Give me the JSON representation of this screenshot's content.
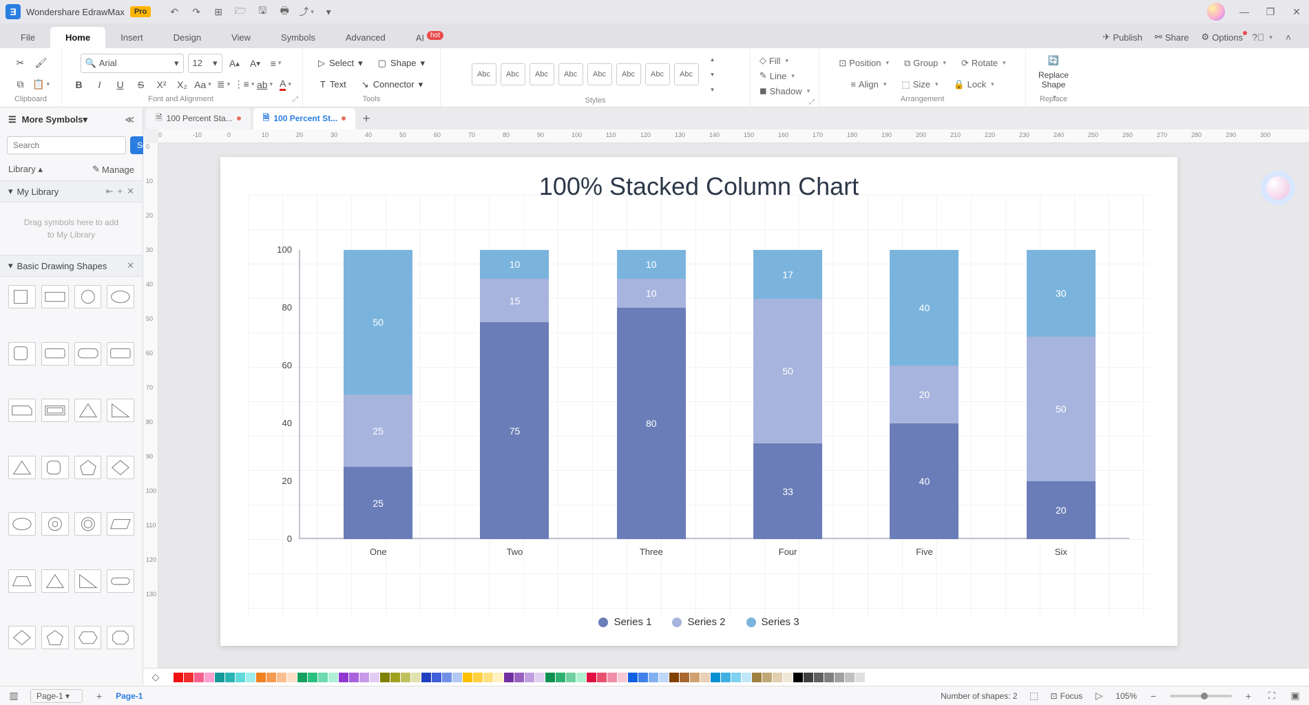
{
  "app": {
    "name": "Wondershare EdrawMax",
    "badge": "Pro"
  },
  "menu": {
    "tabs": [
      "File",
      "Home",
      "Insert",
      "Design",
      "View",
      "Symbols",
      "Advanced",
      "AI"
    ],
    "active": 1,
    "hot_on": 7,
    "right": {
      "publish": "Publish",
      "share": "Share",
      "options": "Options"
    }
  },
  "ribbon": {
    "clipboard": "Clipboard",
    "font_align": "Font and Alignment",
    "font_name": "Arial",
    "font_size": "12",
    "tools": {
      "label": "Tools",
      "select": "Select",
      "shape": "Shape",
      "text": "Text",
      "connector": "Connector"
    },
    "styles": {
      "label": "Styles",
      "sample": "Abc"
    },
    "effects": {
      "fill": "Fill",
      "line": "Line",
      "shadow": "Shadow"
    },
    "arrange": {
      "label": "Arrangement",
      "position": "Position",
      "align": "Align",
      "group": "Group",
      "size": "Size",
      "rotate": "Rotate",
      "lock": "Lock"
    },
    "replace": {
      "btn": "Replace\nShape",
      "label": "Replace"
    }
  },
  "side": {
    "more": "More Symbols",
    "search_ph": "Search",
    "search_btn": "Search",
    "library": "Library",
    "manage": "Manage",
    "mylib": "My Library",
    "drop": "Drag symbols here to add to My Library",
    "basic": "Basic Drawing Shapes"
  },
  "docs": {
    "tabs": [
      {
        "label": "100 Percent Sta...",
        "active": false
      },
      {
        "label": "100 Percent St...",
        "active": true
      }
    ]
  },
  "ruler_h": [
    0,
    -10,
    0,
    10,
    20,
    30,
    40,
    50,
    60,
    70,
    80,
    90,
    100,
    110,
    120,
    130,
    140,
    150,
    160,
    170,
    180,
    190,
    200,
    210,
    220,
    230,
    240,
    250,
    260,
    270,
    280,
    290,
    300
  ],
  "ruler_v": [
    0,
    10,
    20,
    30,
    40,
    50,
    60,
    70,
    80,
    90,
    100,
    110,
    120,
    130
  ],
  "chart_data": {
    "type": "stacked_bar_100",
    "title": "100% Stacked Column Chart",
    "categories": [
      "One",
      "Two",
      "Three",
      "Four",
      "Five",
      "Six"
    ],
    "series": [
      {
        "name": "Series 1",
        "color": "#6a7db8",
        "values": [
          25,
          75,
          80,
          33,
          40,
          20
        ]
      },
      {
        "name": "Series 2",
        "color": "#a7b4dd",
        "values": [
          25,
          15,
          10,
          50,
          20,
          50
        ]
      },
      {
        "name": "Series 3",
        "color": "#7ab4dd",
        "values": [
          50,
          10,
          10,
          17,
          40,
          30
        ]
      }
    ],
    "ylim": [
      0,
      100
    ],
    "yticks": [
      0,
      20,
      40,
      60,
      80,
      100
    ]
  },
  "palette_colors": [
    "#ffffff",
    "#ef1010",
    "#f02e2e",
    "#f75f8f",
    "#fb9fcf",
    "#169999",
    "#2ab3b3",
    "#5fd9d9",
    "#9feded",
    "#f08020",
    "#f59a50",
    "#f9bf90",
    "#fcdfc8",
    "#16a060",
    "#2ac080",
    "#6fd9af",
    "#aff0d7",
    "#9038d0",
    "#a862da",
    "#c79ae8",
    "#e3ccf4",
    "#808000",
    "#a0a020",
    "#c0c060",
    "#e0e0b0",
    "#2040c0",
    "#4060d8",
    "#7090e8",
    "#b0c8f4",
    "#ffc000",
    "#ffd040",
    "#ffe080",
    "#fff0c0",
    "#7030a0",
    "#9860c0",
    "#c0a0e0",
    "#e0d0f0",
    "#109050",
    "#30b070",
    "#70d0a0",
    "#b0f0d0",
    "#e01040",
    "#e85070",
    "#f090a8",
    "#f8c8d4",
    "#1060e0",
    "#4080e8",
    "#80b0f0",
    "#c0d8f8",
    "#804000",
    "#a86830",
    "#d0a070",
    "#e8d0b8",
    "#0090d0",
    "#40b0e0",
    "#80d0f0",
    "#c0e8f8",
    "#a08040",
    "#c0a878",
    "#e0d0b0",
    "#f0e8d8",
    "#000000",
    "#404040",
    "#606060",
    "#808080",
    "#a0a0a0",
    "#c0c0c0",
    "#e0e0e0"
  ],
  "status": {
    "page_sel": "Page-1",
    "page_tab": "Page-1",
    "shapes": "Number of shapes: 2",
    "focus": "Focus",
    "zoom": "105%"
  }
}
